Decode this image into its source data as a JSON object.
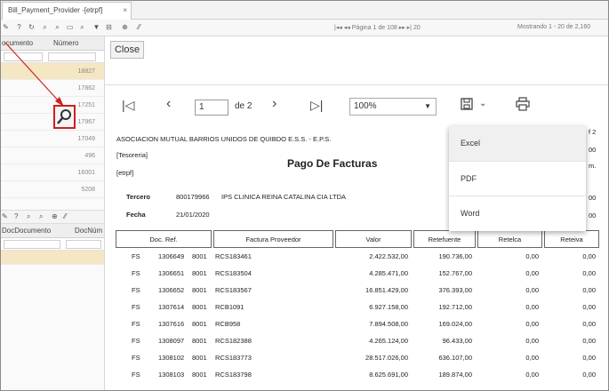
{
  "tab": {
    "title": "Bill_Payment_Provider -[etrpf]",
    "close": "×"
  },
  "toolbar": {
    "pager_text": "|◂◂ ◂◂ Página 1     de 108 ▸▸ ▸| 20",
    "showing_text": "Mostrando 1 - 20 de 2,160"
  },
  "left_panel": {
    "header_top": [
      "ocumento",
      "Número"
    ],
    "rows_top": [
      "18827",
      "17862",
      "17251",
      "17967",
      "17049",
      "496",
      "16001",
      "5208"
    ],
    "header_bottom": [
      "DocDocumento",
      "DocNúm"
    ]
  },
  "close_label": "Close",
  "viewer": {
    "page_value": "1",
    "page_of": "de 2",
    "zoom": "100%",
    "icons": [
      "first-page-icon",
      "prev-page-icon",
      "next-page-icon",
      "last-page-icon",
      "save-icon",
      "print-icon"
    ]
  },
  "export_menu": [
    "Excel",
    "PDF",
    "Word"
  ],
  "report": {
    "org": "ASOCIACION MUTUAL BARRIOS UNIDOS DE QUIBDO E.S.S. - E.P.S.",
    "dept": "[Tesoreria]",
    "code": "[etrpf]",
    "title": "Pago De Facturas",
    "tercero_label": "Tercero",
    "tercero_nit": "800179966",
    "tercero_name": "IPS CLINICA REINA CATALINA CIA LTDA",
    "fecha_label": "Fecha",
    "fecha_value": "21/01/2020",
    "right_clip": [
      "f 2",
      "00",
      "m.",
      "00",
      "00"
    ],
    "columns": [
      "Doc. Ref.",
      "Factura Proveedor",
      "Valor",
      "Retefuente",
      "Retelca",
      "Reteiva"
    ],
    "rows": [
      [
        "FS",
        "1306649",
        "8001",
        "RCS183461",
        "2.422.532,00",
        "190.736,00",
        "0,00",
        "0,00"
      ],
      [
        "FS",
        "1306651",
        "8001",
        "RCS183504",
        "4.285.471,00",
        "152.767,00",
        "0,00",
        "0,00"
      ],
      [
        "FS",
        "1306652",
        "8001",
        "RCS183567",
        "16.851.429,00",
        "376.393,00",
        "0,00",
        "0,00"
      ],
      [
        "FS",
        "1307614",
        "8001",
        "RCB1091",
        "6.927.158,00",
        "192.712,00",
        "0,00",
        "0,00"
      ],
      [
        "FS",
        "1307616",
        "8001",
        "RCB958",
        "7.894.508,00",
        "169.024,00",
        "0,00",
        "0,00"
      ],
      [
        "FS",
        "1308097",
        "8001",
        "RCS182388",
        "4.265.124,00",
        "96.433,00",
        "0,00",
        "0,00"
      ],
      [
        "FS",
        "1308102",
        "8001",
        "RCS183773",
        "28.517.026,00",
        "636.107,00",
        "0,00",
        "0,00"
      ],
      [
        "FS",
        "1308103",
        "8001",
        "RCS183798",
        "8.625.691,00",
        "189.874,00",
        "0,00",
        "0,00"
      ]
    ]
  }
}
